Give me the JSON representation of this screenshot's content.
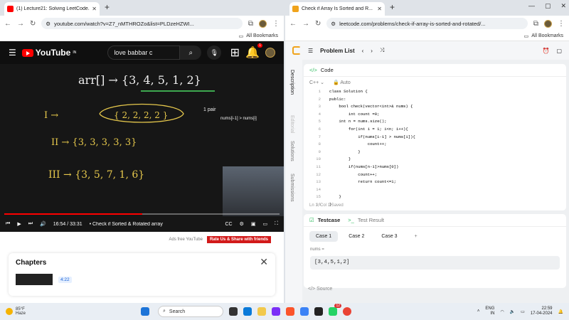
{
  "left": {
    "tab_title": "(1) Lecture21: Solving LeetCode...",
    "url": "youtube.com/watch?v=Z7_nMTHROZo&list=PLDzeHZWI...",
    "bookmarks": "All Bookmarks",
    "yt_logo": "YouTube",
    "yt_region": "IN",
    "search_value": "love babbar c",
    "notif_count": "1",
    "board": {
      "line1": "arr[] → {3, 4, 5, 1, 2}",
      "line2_label": "I  →",
      "line2": "{ ... }",
      "note": "1 pair",
      "note2": "nums[i-1] > nums[i]",
      "line3": "II → {3, 3, 3, 3, 3}",
      "line4": "III → {3, 5, 7, 1, 6}"
    },
    "time": "16:54 / 33:31",
    "chapter_title": "• Check if Sorted & Rotated array",
    "ads": "Ads free YouTube",
    "rate": "Rate Us & Share with friends",
    "chapters_title": "Chapters",
    "chapter_ts": "4:22",
    "progress": 0.5
  },
  "right": {
    "tab_title": "Check if Array Is Sorted and R...",
    "url": "leetcode.com/problems/check-if-array-is-sorted-and-rotated/...",
    "bookmarks": "All Bookmarks",
    "problem_list": "Problem List",
    "side_tabs": [
      "Description",
      "Editorial",
      "Solutions",
      "Submissions"
    ],
    "code_tab": "Code",
    "lang": "C++",
    "auto": "Auto",
    "code_lines": [
      "class Solution {",
      "public:",
      "    bool check(vector<int>& nums) {",
      "        int count =0;",
      "    int n = nums.size();",
      "        for(int i = 1; i<n; i++){",
      "            if(nums[i-1] > nums[i]){",
      "                count++;",
      "            }",
      "        }",
      "        if(nums[n-1]>nums[0])",
      "            count++;",
      "            return count<=1;",
      "",
      "    }",
      "}"
    ],
    "status": "Ln 1, Col 1    Saved",
    "testcase_tab": "Testcase",
    "result_tab": "Test Result",
    "cases": [
      "Case 1",
      "Case 2",
      "Case 3"
    ],
    "field_label": "nums =",
    "field_value": "[3,4,5,1,2]",
    "source": "Source"
  },
  "taskbar": {
    "weather_temp": "85°F",
    "weather_desc": "Haze",
    "search": "Search",
    "lang": "ENG",
    "region": "IN",
    "time": "22:59",
    "date": "17-04-2024",
    "badge": "12"
  }
}
